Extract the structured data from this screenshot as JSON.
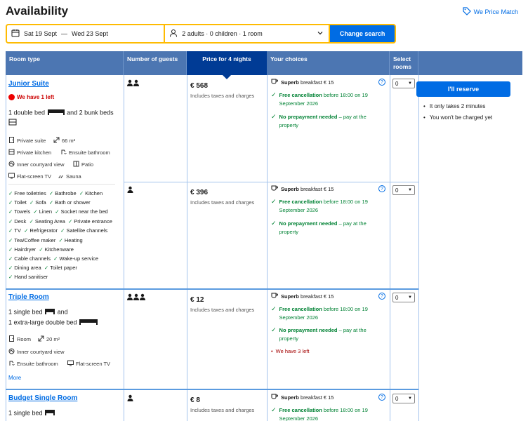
{
  "header": {
    "title": "Availability",
    "price_match": "We Price Match"
  },
  "search": {
    "dates_from": "Sat 19 Sept",
    "dates_sep": "—",
    "dates_to": "Wed 23 Sept",
    "guests": "2 adults · 0 children · 1 room",
    "button": "Change search"
  },
  "table": {
    "headers": [
      "Room type",
      "Number of guests",
      "Price for 4 nights",
      "Your choices",
      "Select rooms"
    ]
  },
  "rooms": [
    {
      "name": "Junior Suite",
      "alert": "We have 1 left",
      "bed_line1_a": "1 double bed",
      "bed_line1_b": "and 2 bunk beds",
      "features": [
        "Private suite",
        "66 m²",
        "Private kitchen",
        "Ensuite bathroom",
        "Inner courtyard view",
        "Patio",
        "Flat-screen TV",
        "Sauna"
      ],
      "amenities": [
        [
          "Free toiletries",
          "Bathrobe",
          "Kitchen"
        ],
        [
          "Toilet",
          "Sofa",
          "Bath or shower"
        ],
        [
          "Towels",
          "Linen",
          "Socket near the bed"
        ],
        [
          "Desk",
          "Seating Area",
          "Private entrance"
        ],
        [
          "TV",
          "Refrigerator",
          "Satellite channels"
        ],
        [
          "Tea/Coffee maker",
          "Heating"
        ],
        [
          "Hairdryer",
          "Kitchenware"
        ],
        [
          "Cable channels",
          "Wake-up service"
        ],
        [
          "Dining area",
          "Toilet paper"
        ],
        [
          "Hand sanitiser"
        ]
      ]
    },
    {
      "name": "Triple Room",
      "bed_line1": "1 single bed",
      "bed_line1_b": "and",
      "bed_line2": "1 extra-large double bed",
      "features": [
        "Room",
        "20 m²",
        "Inner courtyard view",
        "Ensuite bathroom",
        "Flat-screen TV"
      ],
      "more": "More"
    },
    {
      "name": "Budget Single Room",
      "bed_line1": "1 single bed"
    }
  ],
  "offers": [
    {
      "price": "€ 568",
      "note": "Includes taxes and charges",
      "select": "0"
    },
    {
      "price": "€ 396",
      "note": "Includes taxes and charges",
      "select": "0"
    },
    {
      "price": "€ 12",
      "note": "Includes taxes and charges",
      "select": "0",
      "extra": "We have 3 left"
    },
    {
      "price": "€ 8",
      "note": "Includes taxes and charges",
      "select": "0"
    }
  ],
  "choices": {
    "breakfast_bold": "Superb",
    "breakfast_rest": "breakfast € 15",
    "cancel_bold": "Free cancellation",
    "cancel_rest_1": "before 18:00 on 19",
    "cancel_rest_2": "September 2026",
    "prepay_bold": "No prepayment needed",
    "prepay_rest_1": "– pay at the",
    "prepay_rest_2": "property"
  },
  "action": {
    "reserve": "I'll reserve",
    "bullet1": "It only takes 2 minutes",
    "bullet2": "You won't be charged yet"
  },
  "colors": {
    "brand_blue": "#006ce4",
    "header_blue": "#4c76b2",
    "selected_header": "#003b95",
    "search_border": "#febb02",
    "green": "#008234",
    "alert_red": "#cc0000"
  }
}
